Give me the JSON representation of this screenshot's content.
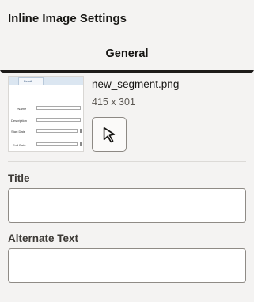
{
  "panel": {
    "title": "Inline Image Settings"
  },
  "tabs": [
    {
      "label": "General",
      "selected": true
    }
  ],
  "image": {
    "file_name": "new_segment.png",
    "dimensions": "415 x 301",
    "thumbnail": {
      "tab_text": "Detail",
      "labels": [
        "*Name",
        "Description",
        "Start Date",
        "End Date"
      ]
    }
  },
  "select_button": {
    "icon": "cursor-arrow-icon"
  },
  "fields": {
    "title": {
      "label": "Title",
      "value": ""
    },
    "alt_text": {
      "label": "Alternate Text",
      "value": ""
    }
  },
  "colors": {
    "accent_underline": "#1d1b19",
    "background": "#f4f3f2"
  }
}
